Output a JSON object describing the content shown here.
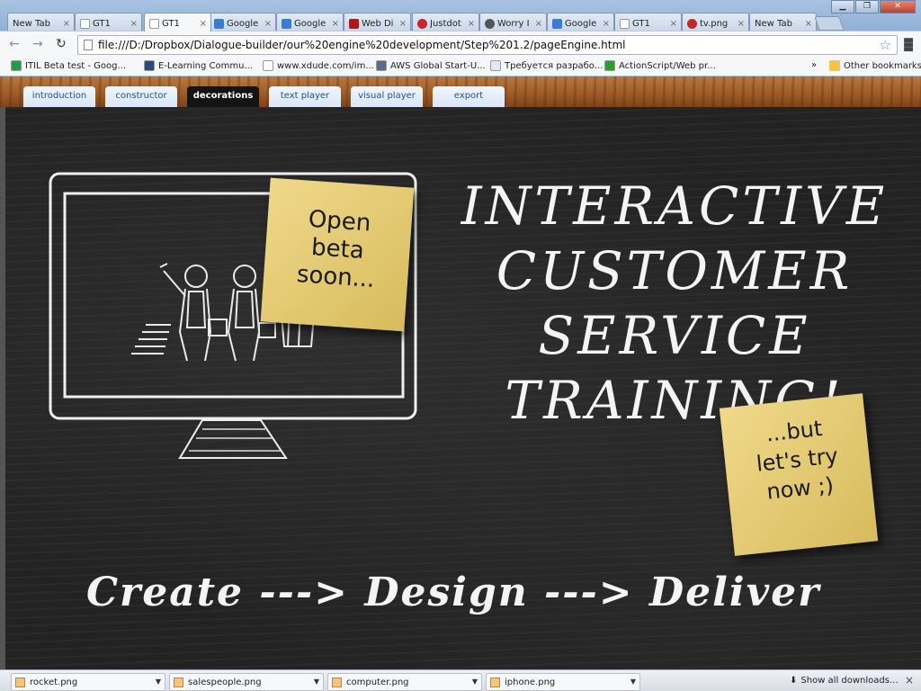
{
  "browser": {
    "tabs": [
      {
        "label": "New Tab",
        "icon": "none",
        "active": false
      },
      {
        "label": "GT1",
        "icon": "doc",
        "active": false
      },
      {
        "label": "GT1",
        "icon": "doc",
        "active": true
      },
      {
        "label": "Google",
        "icon": "google",
        "active": false
      },
      {
        "label": "Google",
        "icon": "google",
        "active": false
      },
      {
        "label": "Web Di",
        "icon": "pdf",
        "active": false
      },
      {
        "label": "Justdot",
        "icon": "red",
        "active": false
      },
      {
        "label": "Worry I",
        "icon": "gray",
        "active": false
      },
      {
        "label": "Google",
        "icon": "google",
        "active": false
      },
      {
        "label": "GT1",
        "icon": "doc",
        "active": false
      },
      {
        "label": "tv.png",
        "icon": "red",
        "active": false
      },
      {
        "label": "New Tab",
        "icon": "none",
        "active": false
      }
    ],
    "url": "file:///D:/Dropbox/Dialogue-builder/our%20engine%20development/Step%201.2/pageEngine.html",
    "bookmarks": [
      {
        "label": "ITIL Beta test - Goog...",
        "icon": "sheets-icon",
        "color": "#1e9e4a"
      },
      {
        "label": "E-Learning Commu...",
        "icon": "e-icon",
        "color": "#2b4a7e"
      },
      {
        "label": "www.xdude.com/im...",
        "icon": "page-icon",
        "color": "#ffffff"
      },
      {
        "label": "AWS Global Start-U...",
        "icon": "h-icon",
        "color": "#5b6c86"
      },
      {
        "label": "Требуется разрабо...",
        "icon": "page-icon",
        "color": "#dde9f7"
      },
      {
        "label": "ActionScript/Web pr...",
        "icon": "o-icon",
        "color": "#2e9d2e"
      }
    ],
    "bookmarks_overflow": "»",
    "other_bookmarks": "Other bookmarks"
  },
  "site": {
    "nav_tabs": [
      {
        "label": "introduction",
        "active": false
      },
      {
        "label": "constructor",
        "active": false
      },
      {
        "label": "decorations",
        "active": true
      },
      {
        "label": "text player",
        "active": false
      },
      {
        "label": "visual player",
        "active": false
      },
      {
        "label": "export",
        "active": false
      }
    ],
    "sticky_beta": [
      "Open",
      "beta",
      "soon..."
    ],
    "headline": [
      "INTERACTIVE",
      "CUSTOMER",
      "SERVICE",
      "TRAINING!"
    ],
    "sticky_try": [
      "...but",
      "let's try",
      "now ;)"
    ],
    "tagline": "Create ---> Design ---> Deliver"
  },
  "downloads": {
    "items": [
      "rocket.png",
      "salespeople.png",
      "computer.png",
      "iphone.png"
    ],
    "show_all": "Show all downloads...",
    "close": "×"
  }
}
